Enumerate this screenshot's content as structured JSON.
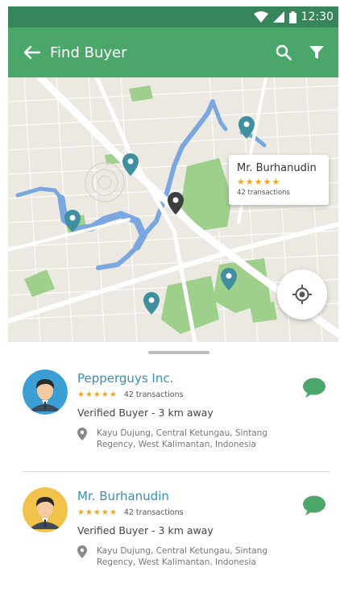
{
  "status_bar": {
    "time": "12:30"
  },
  "app_bar": {
    "title": "Find Buyer"
  },
  "map": {
    "callout": {
      "name": "Mr. Burhanudin",
      "stars": "★★★★★",
      "transactions": "42 transactions"
    }
  },
  "buyers": [
    {
      "name": "Pepperguys Inc.",
      "stars": "★★★★★",
      "transactions": "42 transactions",
      "verified": "Verified Buyer - 3 km away",
      "address": "Kayu Dujung, Central Ketungau, Sintang Regency, West Kalimantan, Indonesia",
      "avatar_bg": "#3b9fd6"
    },
    {
      "name": "Mr. Burhanudin",
      "stars": "★★★★★",
      "transactions": "42 transactions",
      "verified": "Verified Buyer - 3 km away",
      "address": "Kayu Dujung, Central Ketungau, Sintang Regency, West Kalimantan, Indonesia",
      "avatar_bg": "#f3c24a"
    }
  ],
  "colors": {
    "primary": "#4ba66a",
    "primary_dark": "#37855a",
    "link": "#3a8fb0",
    "star": "#f0a623",
    "pin": "#3f8f9e",
    "chat": "#4ba66a"
  },
  "icons": [
    "back-arrow-icon",
    "search-icon",
    "filter-icon",
    "map-pin-icon",
    "my-location-icon",
    "chat-icon",
    "location-pin-icon",
    "wifi-icon",
    "signal-icon",
    "battery-icon"
  ]
}
